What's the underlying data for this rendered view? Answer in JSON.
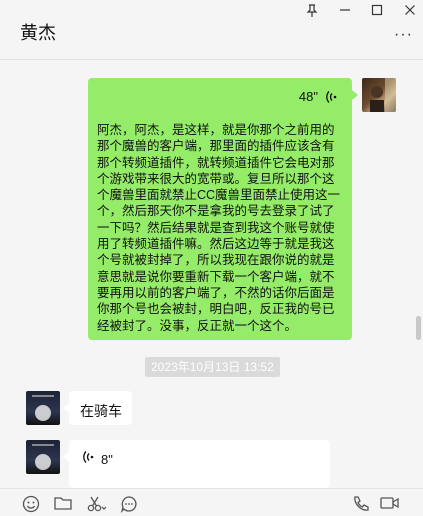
{
  "window": {
    "title": "黄杰",
    "pin_icon": "pin-icon",
    "minimize_icon": "minimize-icon",
    "maximize_icon": "maximize-icon",
    "close_icon": "close-icon",
    "more_icon": "more-icon"
  },
  "messages": [
    {
      "sender": "self",
      "type": "voice",
      "duration": "48\"",
      "transcript": "阿杰，阿杰，是这样，就是你那个之前用的那个魔兽的客户端，那里面的插件应该含有那个转频道插件，就转频道插件它会电对那个游戏带来很大的宽带或。复旦所以那个这个魔兽里面就禁止CC魔兽里面禁止使用这一个，然后那天你不是拿我的号去登录了试了一下吗？然后结果就是查到我这个账号就使用了转频道插件嘛。然后这边等于就是我这个号就被封掉了，所以我现在跟你说的就是意思就是说你要重新下载一个客户端，就不要再用以前的客户端了，不然的话你后面是你那个号也会被封，明白吧，反正我的号已经被封了。没事，反正就一个这个。"
    },
    {
      "sender": "system",
      "type": "timestamp",
      "text": "2023年10月13日 13:52"
    },
    {
      "sender": "other",
      "type": "text",
      "text": "在骑车"
    },
    {
      "sender": "other",
      "type": "voice",
      "duration": "8\""
    }
  ],
  "toolbar": {
    "icons": [
      "emoji-icon",
      "folder-icon",
      "scissors-icon",
      "chat-history-icon",
      "phone-icon",
      "video-call-icon"
    ]
  }
}
